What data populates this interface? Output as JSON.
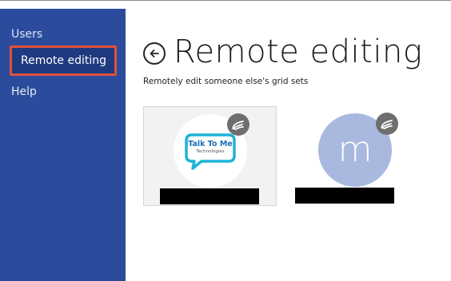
{
  "sidebar": {
    "items": [
      {
        "label": "Users"
      },
      {
        "label": "Remote editing"
      },
      {
        "label": "Help"
      }
    ]
  },
  "header": {
    "title": "Remote editing",
    "subtitle": "Remotely edit someone else's grid sets"
  },
  "cards": [
    {
      "avatar_type": "logo",
      "logo_text": "Talk To Me",
      "logo_subtext": "Technologies",
      "badge_icon": "remote-hand-icon",
      "name": ""
    },
    {
      "avatar_type": "letter",
      "avatar_letter": "m",
      "badge_icon": "remote-hand-icon",
      "name": ""
    }
  ],
  "colors": {
    "sidebar_bg": "#2b4c9c",
    "selected_outline": "#e0503c",
    "avatar_bg": "#a8b8df",
    "badge_bg": "#6e6e6e",
    "logo_blue": "#1d6fb8",
    "logo_cyan": "#1fb3d8"
  }
}
